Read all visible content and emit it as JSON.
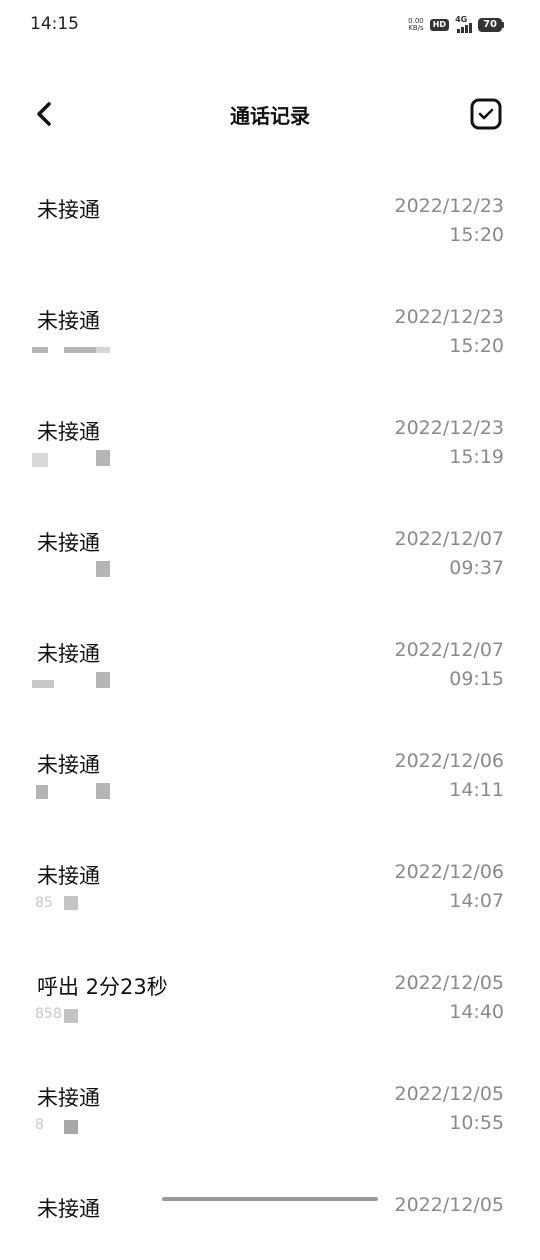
{
  "status_bar": {
    "time": "14:15",
    "net_speed_value": "0.00",
    "net_speed_unit": "KB/s",
    "hd_label": "HD",
    "network_type": "4G",
    "battery": "70"
  },
  "header": {
    "title": "通话记录",
    "back_icon": "chevron-left-icon",
    "select_icon": "checkbox-checked-icon"
  },
  "calls": [
    {
      "status": "未接通",
      "number": "",
      "date": "2022/12/23",
      "time": "15:20"
    },
    {
      "status": "未接通",
      "number": "",
      "date": "2022/12/23",
      "time": "15:20"
    },
    {
      "status": "未接通",
      "number": "",
      "date": "2022/12/23",
      "time": "15:19"
    },
    {
      "status": "未接通",
      "number": "",
      "date": "2022/12/07",
      "time": "09:37"
    },
    {
      "status": "未接通",
      "number": "",
      "date": "2022/12/07",
      "time": "09:15"
    },
    {
      "status": "未接通",
      "number": "",
      "date": "2022/12/06",
      "time": "14:11"
    },
    {
      "status": "未接通",
      "number": "85",
      "date": "2022/12/06",
      "time": "14:07"
    },
    {
      "status": "呼出 2分23秒",
      "number": "858",
      "date": "2022/12/05",
      "time": "14:40"
    },
    {
      "status": "未接通",
      "number": "8",
      "date": "2022/12/05",
      "time": "10:55"
    },
    {
      "status": "未接通",
      "number": "",
      "date": "2022/12/05",
      "time": ""
    }
  ],
  "colors": {
    "title": "#111111",
    "secondary_text": "#8a8a8a",
    "background": "#ffffff"
  }
}
